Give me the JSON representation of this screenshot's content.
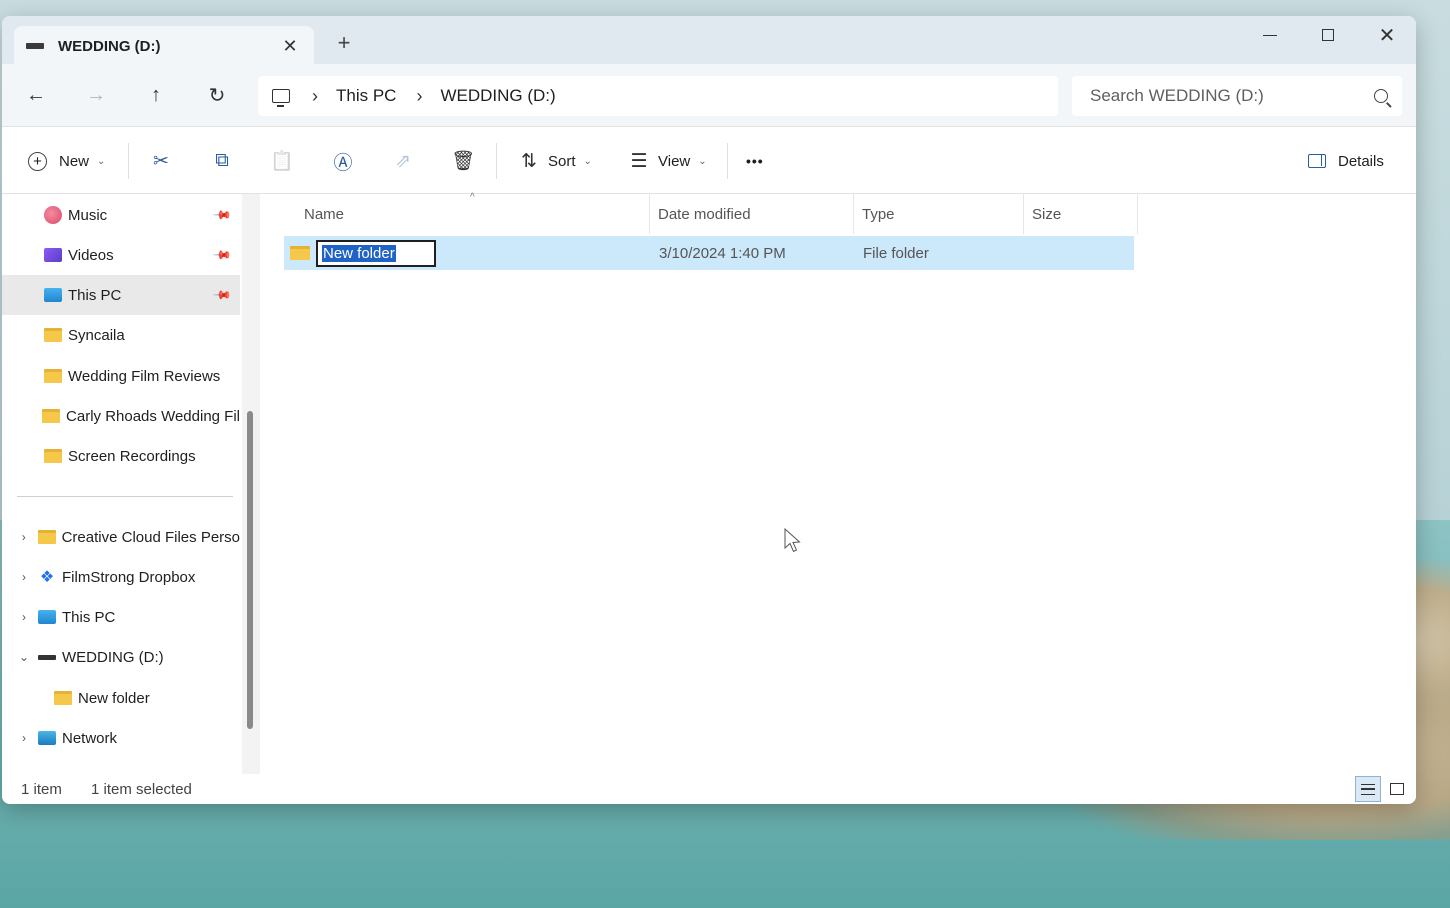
{
  "window": {
    "tab_title": "WEDDING (D:)",
    "tab_close": "✕",
    "tab_add": "+",
    "minimize": "minimize",
    "maximize": "maximize",
    "close": "✕"
  },
  "nav": {
    "back": "←",
    "forward": "→",
    "up": "↑",
    "refresh": "↻",
    "breadcrumb": [
      "This PC",
      "WEDDING (D:)"
    ],
    "separator": "›",
    "search_placeholder": "Search WEDDING (D:)"
  },
  "toolbar": {
    "new_label": "New",
    "sort_label": "Sort",
    "view_label": "View",
    "more_label": "•••",
    "details_label": "Details",
    "icons": [
      "cut-icon",
      "copy-icon",
      "paste-icon",
      "rename-icon",
      "share-icon",
      "delete-icon"
    ],
    "icon_glyphs": {
      "cut": "✂",
      "copy": "⧉",
      "paste": "📋",
      "rename": "Ⓐ",
      "share": "⇗",
      "delete": "🗑",
      "sort": "⇅",
      "view": "☰"
    }
  },
  "sidebar": {
    "pinned": [
      {
        "label": "Music",
        "icon": "music-icon",
        "pinned": true
      },
      {
        "label": "Videos",
        "icon": "videos-icon",
        "pinned": true
      },
      {
        "label": "This PC",
        "icon": "this-pc-icon",
        "pinned": true,
        "selected": true
      },
      {
        "label": "Syncaila",
        "icon": "folder-icon"
      },
      {
        "label": "Wedding Film Reviews",
        "icon": "folder-icon"
      },
      {
        "label": "Carly Rhoads Wedding Fil",
        "icon": "folder-icon"
      },
      {
        "label": "Screen Recordings",
        "icon": "folder-icon"
      }
    ],
    "tree": [
      {
        "label": "Creative Cloud Files Perso",
        "icon": "folder-icon",
        "expand": "›"
      },
      {
        "label": "FilmStrong Dropbox",
        "icon": "dropbox-icon",
        "expand": "›"
      },
      {
        "label": "This PC",
        "icon": "this-pc-icon",
        "expand": "›"
      },
      {
        "label": "WEDDING (D:)",
        "icon": "drive-icon",
        "expand": "⌄"
      },
      {
        "label": "New folder",
        "icon": "folder-icon",
        "expand": ""
      },
      {
        "label": "Network",
        "icon": "network-icon",
        "expand": "›"
      }
    ],
    "pin_glyph": "📌"
  },
  "columns": [
    "Name",
    "Date modified",
    "Type",
    "Size"
  ],
  "files": [
    {
      "name": "New folder",
      "date": "3/10/2024 1:40 PM",
      "type": "File folder",
      "size": ""
    }
  ],
  "status": {
    "count": "1 item",
    "selected": "1 item selected"
  },
  "colors": {
    "accent": "#1f63c6",
    "selection": "#cce8fb",
    "folder": "#f5c84a"
  }
}
